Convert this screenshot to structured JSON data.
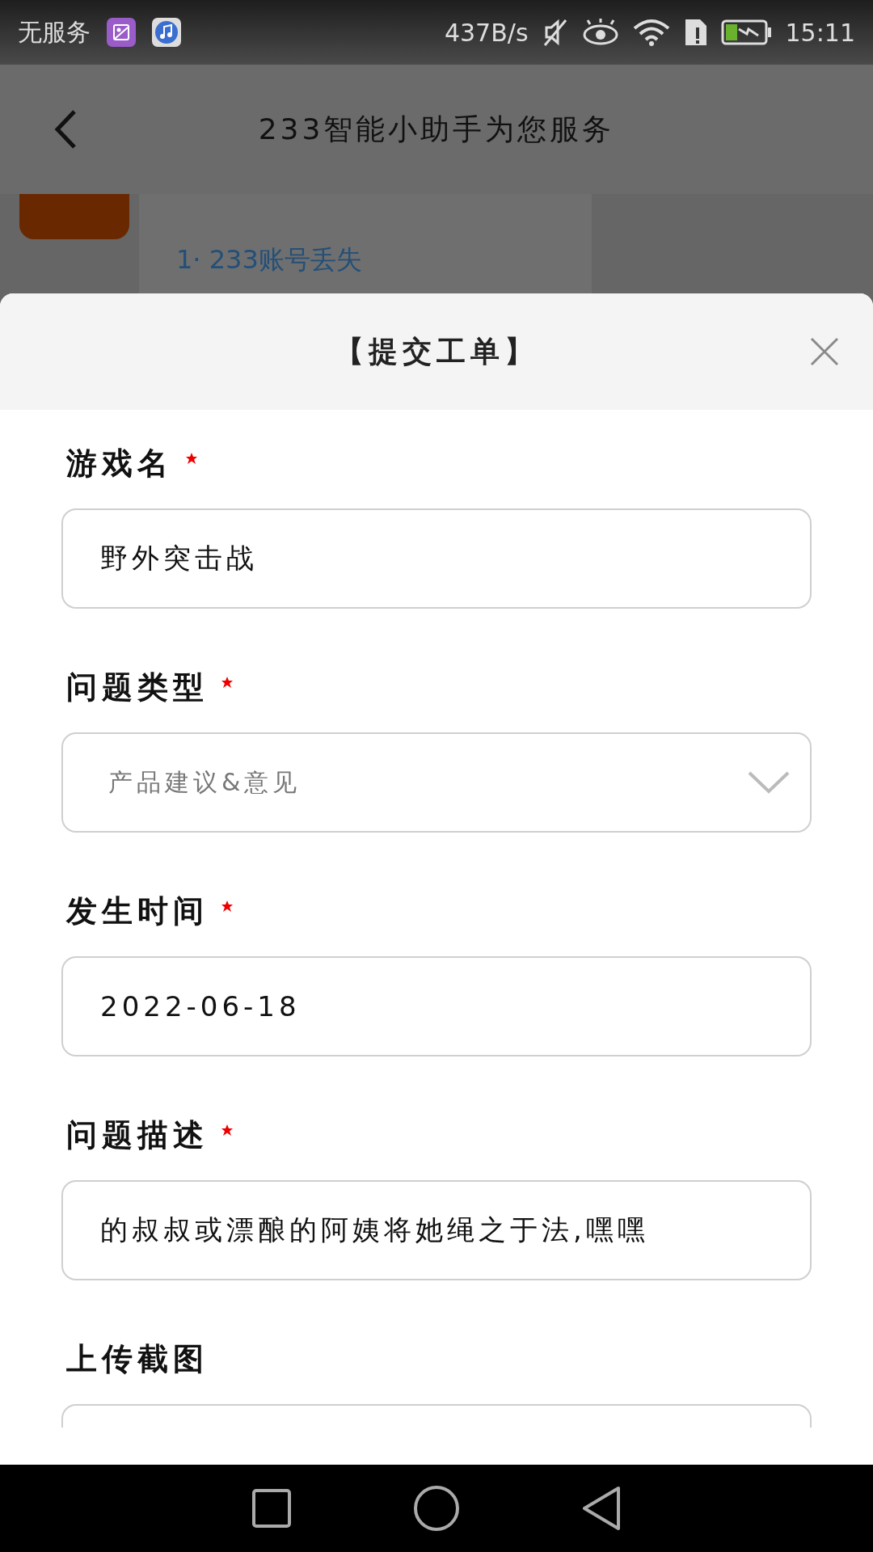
{
  "status_bar": {
    "carrier": "无服务",
    "speed": "437B/s",
    "time": "15:11"
  },
  "header": {
    "title": "233智能小助手为您服务"
  },
  "background_content": {
    "link": "1· 233账号丢失"
  },
  "sheet": {
    "title": "【提交工单】",
    "fields": [
      {
        "kind": "text",
        "label": "游戏名",
        "required": true,
        "value": "野外突击战"
      },
      {
        "kind": "select",
        "label": "问题类型",
        "required": true,
        "value": "产品建议&意见"
      },
      {
        "kind": "text",
        "label": "发生时间",
        "required": true,
        "value": "2022-06-18"
      },
      {
        "kind": "text",
        "label": "问题描述",
        "required": true,
        "value": "的叔叔或漂酿的阿姨将她绳之于法,嘿嘿"
      },
      {
        "kind": "upload",
        "label": "上传截图",
        "required": false
      }
    ]
  }
}
